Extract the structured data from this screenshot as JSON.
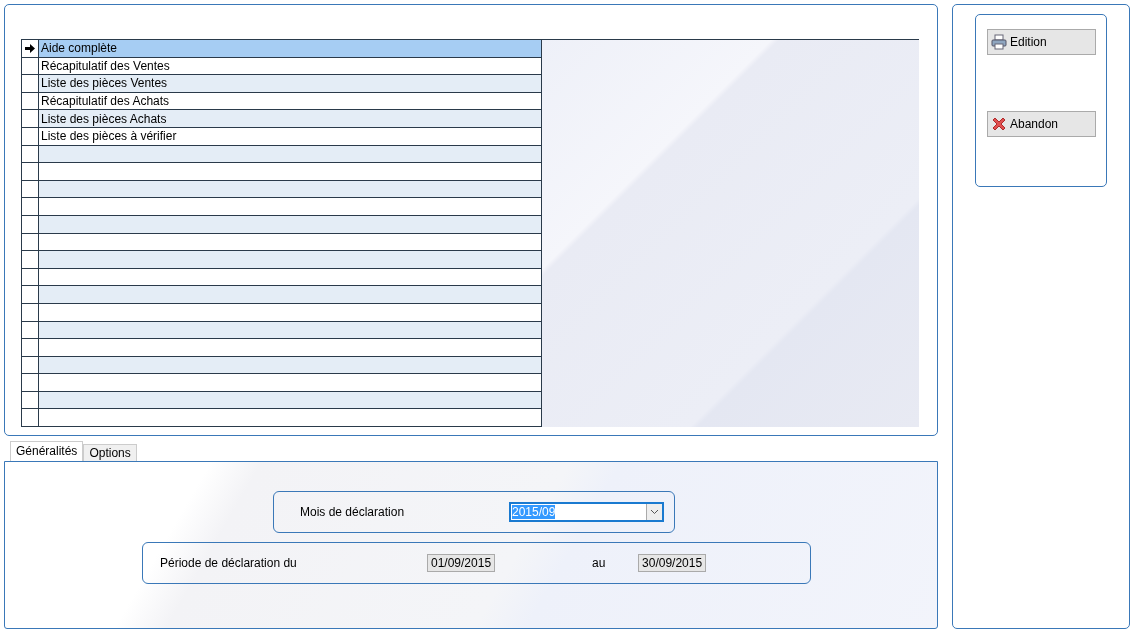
{
  "list": {
    "rows": [
      {
        "label": "Aide complète",
        "selected": true
      },
      {
        "label": "Récapitulatif des Ventes",
        "selected": false
      },
      {
        "label": "Liste des pièces Ventes",
        "selected": false
      },
      {
        "label": "Récapitulatif des Achats",
        "selected": false
      },
      {
        "label": "Liste des pièces Achats",
        "selected": false
      },
      {
        "label": "Liste des pièces à vérifier",
        "selected": false
      }
    ]
  },
  "tabs": [
    {
      "label": "Généralités",
      "selected": true
    },
    {
      "label": "Options",
      "selected": false
    }
  ],
  "month": {
    "label": "Mois de déclaration",
    "value": "2015/09"
  },
  "period": {
    "label": "Période de déclaration du",
    "from": "01/09/2015",
    "to_label": "au",
    "to": "30/09/2015"
  },
  "buttons": [
    {
      "kind": "print",
      "label": "Edition"
    },
    {
      "kind": "cancel",
      "label": "Abandon"
    }
  ]
}
